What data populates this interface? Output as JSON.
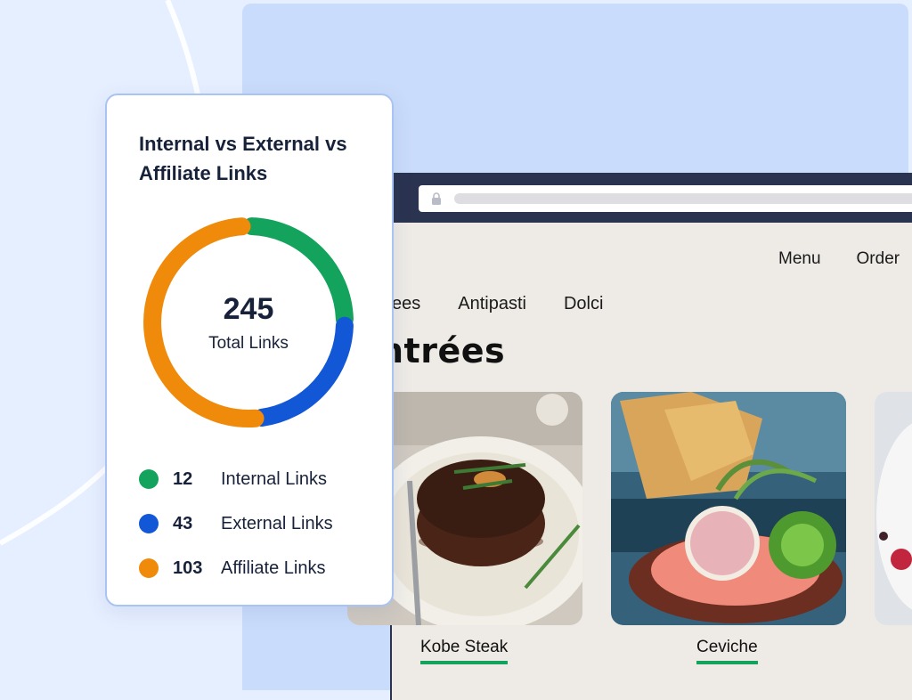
{
  "colors": {
    "internal": "#14a35c",
    "external": "#1257d6",
    "affiliate": "#f08a0b",
    "accent_underline": "#14a35c",
    "browser_bar": "#2a3350"
  },
  "browser": {
    "top_nav": [
      "Menu",
      "Order"
    ],
    "categories": [
      "ees",
      "Antipasti",
      "Dolci"
    ],
    "section_title": "ntrées",
    "dishes": [
      {
        "name": "Kobe Steak"
      },
      {
        "name": "Ceviche"
      }
    ]
  },
  "card": {
    "title": "Internal vs External vs Affiliate Links",
    "total_value": "245",
    "total_label": "Total Links",
    "legend": [
      {
        "count": "12",
        "label": "Internal Links",
        "color": "#14a35c"
      },
      {
        "count": "43",
        "label": "External Links",
        "color": "#1257d6"
      },
      {
        "count": "103",
        "label": "Affiliate Links",
        "color": "#f08a0b"
      }
    ]
  },
  "chart_data": {
    "type": "pie",
    "categories": [
      "Internal Links",
      "External Links",
      "Affiliate Links"
    ],
    "values": [
      12,
      43,
      103
    ],
    "center_value": 245,
    "center_label": "Total Links"
  }
}
